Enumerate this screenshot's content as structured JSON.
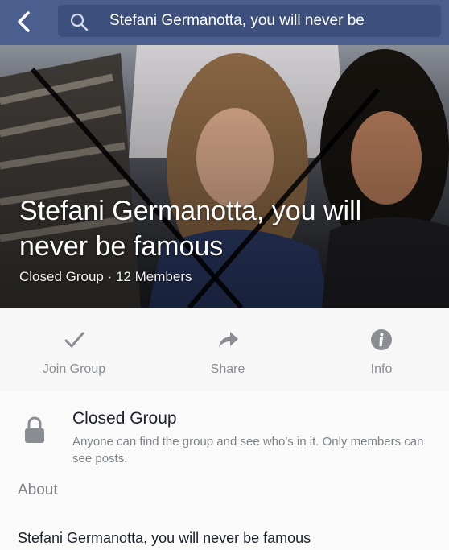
{
  "search": {
    "query": "Stefani Germanotta, you will never be"
  },
  "cover": {
    "title_line1": "Stefani Germanotta, you will",
    "title_line2": "never be famous",
    "subtitle": "Closed Group · 12 Members"
  },
  "actions": [
    {
      "label": "Join Group",
      "icon": "checkmark-icon"
    },
    {
      "label": "Share",
      "icon": "share-arrow-icon"
    },
    {
      "label": "Info",
      "icon": "info-icon"
    }
  ],
  "privacy": {
    "title": "Closed Group",
    "description": "Anyone can find the group and see who's in it. Only members can see posts.",
    "icon": "lock-icon"
  },
  "about": {
    "heading": "About",
    "text": "Stefani Germanotta, you will never be famous"
  },
  "colors": {
    "header": "#4b5f8f",
    "search_field": "#3d4f7c",
    "secondary_text": "#8a8d91"
  }
}
